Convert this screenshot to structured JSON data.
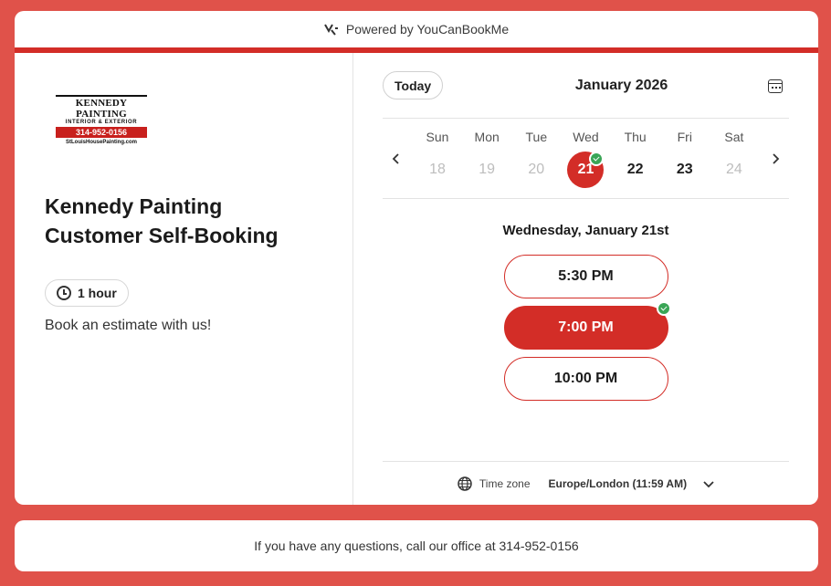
{
  "branding": {
    "powered_by": "Powered by YouCanBookMe"
  },
  "logo": {
    "line1": "KENNEDY PAINTING",
    "line2": "INTERIOR & EXTERIOR",
    "line3": "314-952-0156",
    "line4": "StLouisHousePainting.com"
  },
  "booking": {
    "title": "Kennedy Painting Customer Self-Booking",
    "duration": "1 hour",
    "description": "Book an estimate with us!"
  },
  "calendar": {
    "today_label": "Today",
    "month": "January 2026",
    "days": [
      {
        "name": "Sun",
        "num": "18",
        "state": "disabled"
      },
      {
        "name": "Mon",
        "num": "19",
        "state": "disabled"
      },
      {
        "name": "Tue",
        "num": "20",
        "state": "disabled"
      },
      {
        "name": "Wed",
        "num": "21",
        "state": "selected"
      },
      {
        "name": "Thu",
        "num": "22",
        "state": "available"
      },
      {
        "name": "Fri",
        "num": "23",
        "state": "available"
      },
      {
        "name": "Sat",
        "num": "24",
        "state": "disabled"
      }
    ]
  },
  "slots": {
    "selected_date": "Wednesday, January 21st",
    "times": [
      "5:30 PM",
      "7:00 PM",
      "10:00 PM"
    ],
    "selected_index": 1
  },
  "timezone": {
    "label": "Time zone",
    "value": "Europe/London (11:59 AM)"
  },
  "footer": {
    "text": "If you have any questions, call our office at 314-952-0156"
  },
  "colors": {
    "background": "#e0524a",
    "accent": "#d32d27",
    "check": "#3aa556"
  }
}
